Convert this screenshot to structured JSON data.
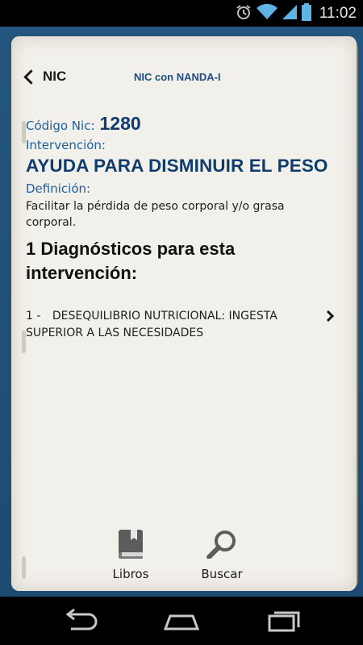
{
  "status_bar": {
    "time": "11:02",
    "icons": [
      "alarm-icon",
      "wifi-icon",
      "signal-icon",
      "battery-icon"
    ]
  },
  "header": {
    "back_label": "NIC",
    "title": "NIC con NANDA-I"
  },
  "nic": {
    "code_label": "Código Nic:",
    "code_value": "1280",
    "intervention_label": "Intervención:",
    "intervention_title": "AYUDA PARA DISMINUIR EL PESO",
    "definition_label": "Definición:",
    "definition_text": "Facilitar la pérdida de peso corporal y/o grasa corporal."
  },
  "diagnoses": {
    "heading": "1 Diagnósticos para esta intervención:",
    "items": [
      {
        "number": "1 -",
        "text": "DESEQUILIBRIO NUTRICIONAL: INGESTA SUPERIOR A LAS NECESIDADES"
      }
    ]
  },
  "bottom_nav": {
    "libros_label": "Libros",
    "buscar_label": "Buscar"
  },
  "colors": {
    "accent_blue": "#0f3c6e",
    "label_blue": "#1d5f9e",
    "book_blue": "#1f4f78",
    "paper": "#f2f0ea"
  }
}
